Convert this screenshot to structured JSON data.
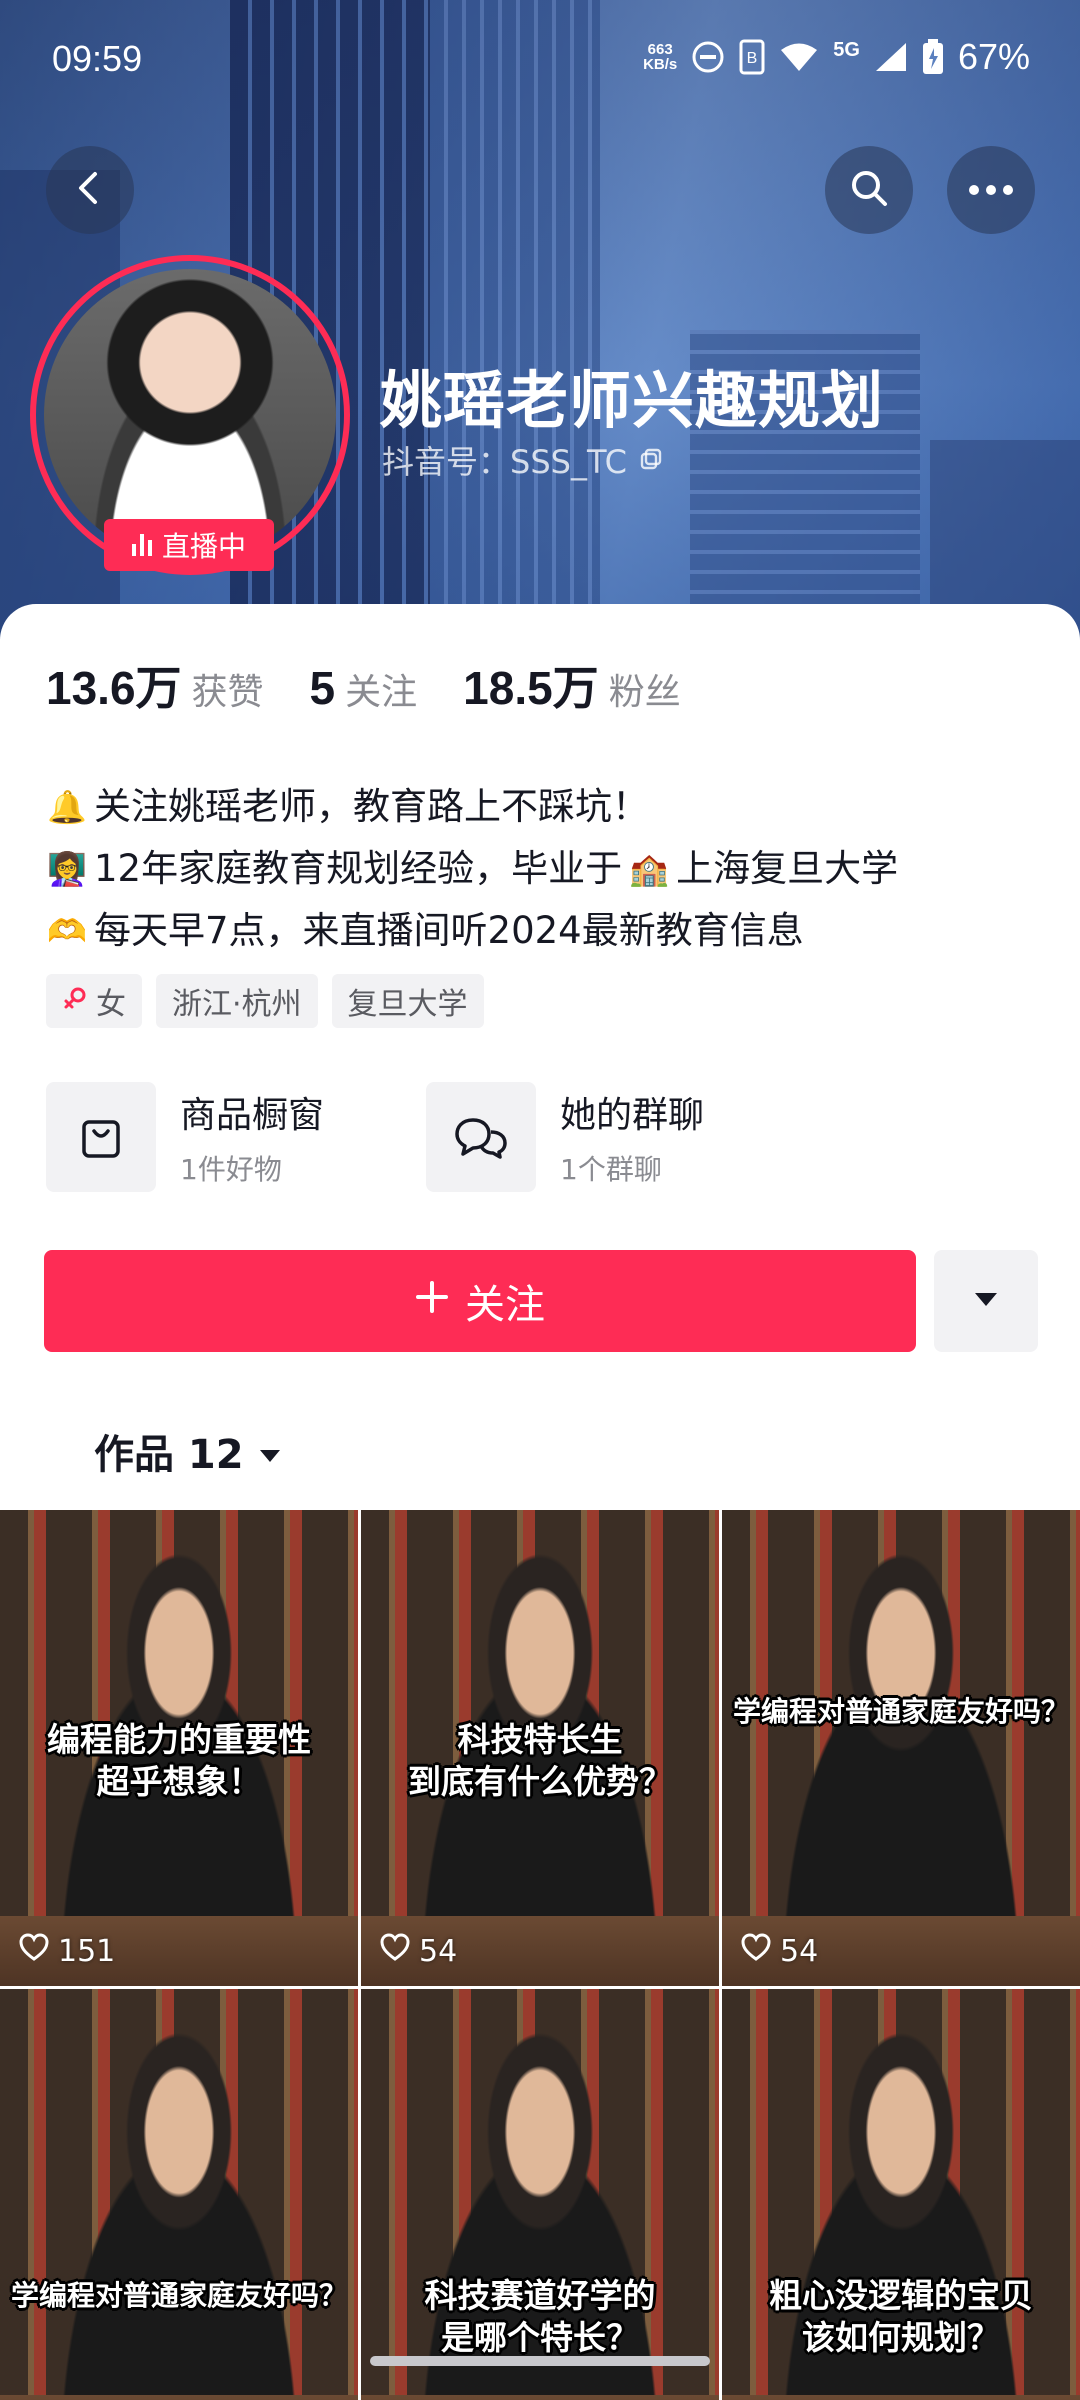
{
  "status_bar": {
    "time": "09:59",
    "net_speed_value": "663",
    "net_speed_unit": "KB/s",
    "network": "5G",
    "battery": "67%"
  },
  "profile": {
    "nickname": "姚瑶老师兴趣规划",
    "douyin_id": "抖音号：SSS_TC",
    "live_badge": "直播中"
  },
  "stats": [
    {
      "value": "13.6万",
      "label": "获赞"
    },
    {
      "value": "5",
      "label": "关注"
    },
    {
      "value": "18.5万",
      "label": "粉丝"
    }
  ],
  "bio": [
    {
      "emoji": "🔔",
      "text": "关注姚瑶老师，教育路上不踩坑！"
    },
    {
      "emoji": "👩‍🏫",
      "text": "12年家庭教育规划经验，毕业于",
      "emoji2": "🏫",
      "text2": "上海复旦大学"
    },
    {
      "emoji": "🫶",
      "text": "每天早7点，来直播间听2024最新教育信息"
    }
  ],
  "tags": [
    "女",
    "浙江·杭州",
    "复旦大学"
  ],
  "entries": [
    {
      "title": "商品橱窗",
      "sub": "1件好物",
      "icon": "shopping-bag-icon"
    },
    {
      "title": "她的群聊",
      "sub": "1个群聊",
      "icon": "chat-bubbles-icon"
    }
  ],
  "follow_button": "关注",
  "works_tab": "作品 12",
  "videos": [
    {
      "caption": "编程能力的重要性\n超乎想象！",
      "likes": "151"
    },
    {
      "caption": "科技特长生\n到底有什么优势？",
      "likes": "54"
    },
    {
      "caption": "学编程对普通家庭友好吗？",
      "likes": "54"
    },
    {
      "caption": "学编程对普通家庭友好吗？",
      "likes": ""
    },
    {
      "caption": "科技赛道好学的\n是哪个特长？",
      "likes": ""
    },
    {
      "caption": "粗心没逻辑的宝贝\n该如何规划？",
      "likes": ""
    }
  ],
  "colors": {
    "accent": "#fe2c55",
    "muted_text": "#8a8b91",
    "chip_bg": "#f2f2f4"
  }
}
